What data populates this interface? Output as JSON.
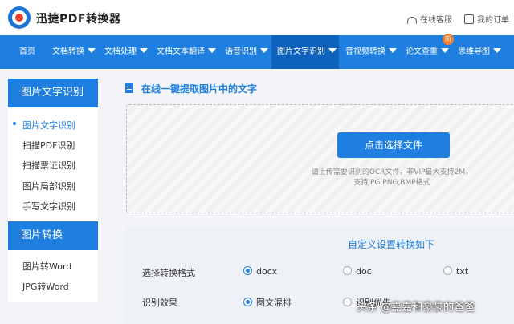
{
  "header": {
    "brand": "迅捷PDF转换器",
    "service_link": "在线客服",
    "account_link": "我的订单"
  },
  "nav": {
    "items": [
      {
        "label": "首页"
      },
      {
        "label": "文档转换"
      },
      {
        "label": "文档处理"
      },
      {
        "label": "文档文本翻译"
      },
      {
        "label": "语音识别"
      },
      {
        "label": "图片文字识别"
      },
      {
        "label": "音视频转换"
      },
      {
        "label": "论文查重"
      },
      {
        "label": "思维导图"
      }
    ],
    "new_badge": "新"
  },
  "sidebar": {
    "group1_title": "图片文字识别",
    "group1_items": [
      "图片文字识别",
      "扫描PDF识别",
      "扫描票证识别",
      "图片局部识别",
      "手写文字识别"
    ],
    "group2_title": "图片转换",
    "group2_items": [
      "图片转Word",
      "JPG转Word"
    ]
  },
  "main": {
    "section_title": "在线一键提取图片中的文字",
    "upload_button": "点击选择文件",
    "upload_hint_line1": "请上传需要识别的OCR文件，非VIP最大支持2M，",
    "upload_hint_line2": "支持JPG,PNG,BMP格式"
  },
  "settings": {
    "title": "自定义设置转换如下",
    "format_label": "选择转换格式",
    "format_options": [
      "docx",
      "doc",
      "txt"
    ],
    "effect_label": "识别效果",
    "effect_options": [
      "图文混排",
      "识别优先"
    ]
  },
  "watermark": "头条 @嘉嘉和豪豪的爸爸"
}
